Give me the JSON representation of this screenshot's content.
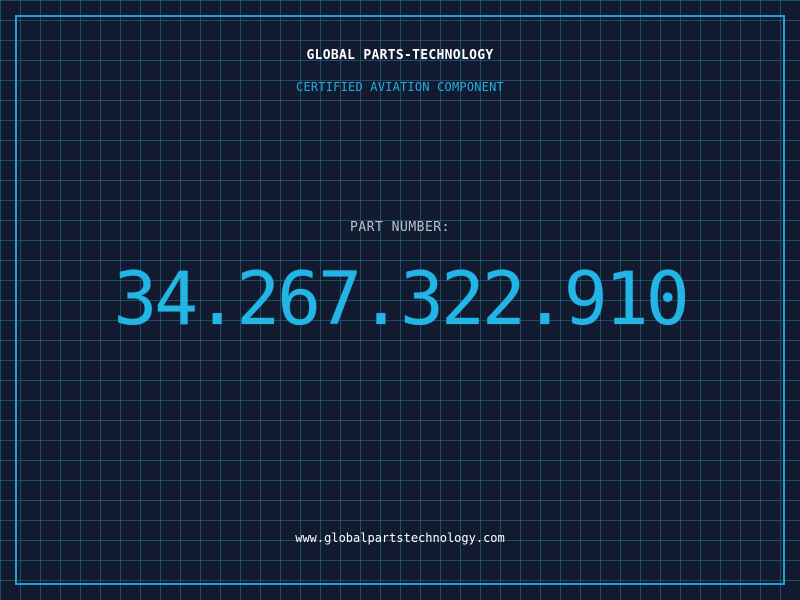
{
  "header": {
    "company_name": "GLOBAL PARTS-TECHNOLOGY",
    "subtitle": "CERTIFIED AVIATION COMPONENT"
  },
  "part": {
    "label": "PART NUMBER:",
    "number": "34.267.322.910"
  },
  "footer": {
    "url": "www.globalpartstechnology.com"
  },
  "colors": {
    "background": "#111a2e",
    "grid": "#267896",
    "accent": "#22b5e6",
    "frame": "#1aa3d4",
    "label": "#b7c0cc"
  }
}
